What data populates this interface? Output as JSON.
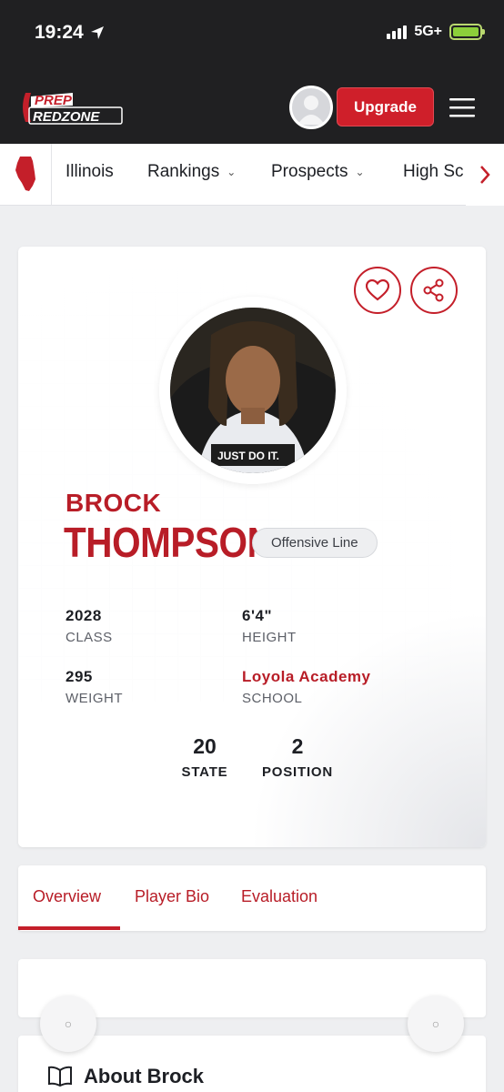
{
  "status": {
    "time": "19:24",
    "network": "5G+"
  },
  "header": {
    "logo_top": "PREP",
    "logo_bottom": "REDZONE",
    "upgrade_label": "Upgrade"
  },
  "nav": {
    "state": "Illinois",
    "rankings": "Rankings",
    "prospects": "Prospects",
    "high_school": "High Sc"
  },
  "player": {
    "first_name": "BROCK",
    "last_name": "THOMPSON",
    "position": "Offensive Line",
    "shirt_text": "JUST DO IT.",
    "stats": [
      {
        "value": "2028",
        "label": "CLASS"
      },
      {
        "value": "6'4\"",
        "label": "HEIGHT"
      },
      {
        "value": "295",
        "label": "WEIGHT"
      },
      {
        "value": "Loyola Academy",
        "label": "SCHOOL"
      }
    ],
    "ranks": [
      {
        "value": "20",
        "label": "STATE"
      },
      {
        "value": "2",
        "label": "POSITION"
      }
    ]
  },
  "tabs": [
    "Overview",
    "Player Bio",
    "Evaluation"
  ],
  "about_title": "About Brock",
  "colors": {
    "brand_red": "#c41f2a",
    "header_bg": "#202022",
    "accent_text": "#b81d27"
  }
}
